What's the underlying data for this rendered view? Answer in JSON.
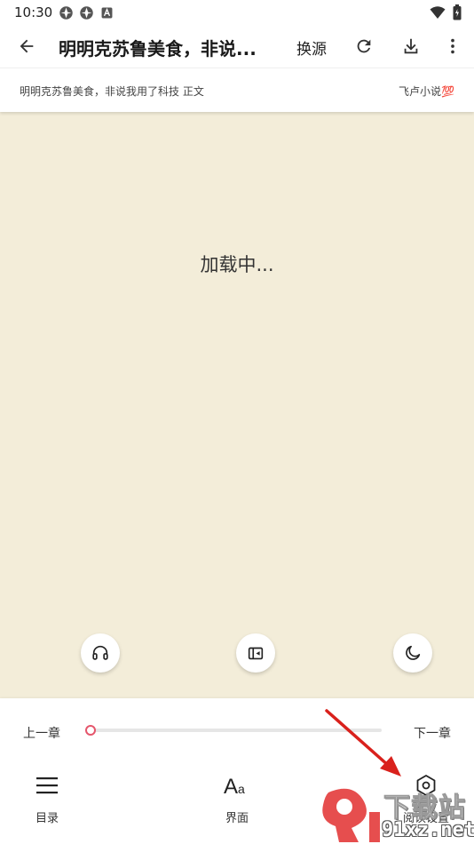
{
  "status_bar": {
    "time": "10:30"
  },
  "toolbar": {
    "title": "明明克苏鲁美食，非说...",
    "change_source": "换源",
    "icons": [
      "back-arrow-icon",
      "refresh-icon",
      "download-icon",
      "more-vert-icon"
    ]
  },
  "chapter_info": {
    "chapter": "明明克苏鲁美食，非说我用了科技 正文",
    "source": "飞卢小说💯"
  },
  "reader": {
    "loading_text": "加载中...",
    "background_color": "#f3edd9",
    "float_buttons": [
      "headphones-icon",
      "auto-page-icon",
      "night-mode-icon"
    ]
  },
  "bottom_panel": {
    "prev_chapter": "上一章",
    "next_chapter": "下一章",
    "progress": 0.0,
    "accent_color": "#e5566c",
    "menu": [
      {
        "label": "目录",
        "icon": "menu-list-icon"
      },
      {
        "label": "界面",
        "icon": "font-style-icon"
      },
      {
        "label": "阅读设置",
        "icon": "settings-icon"
      }
    ]
  },
  "watermark": {
    "text_cn": "下载站",
    "text_domain": "91xz.net"
  }
}
